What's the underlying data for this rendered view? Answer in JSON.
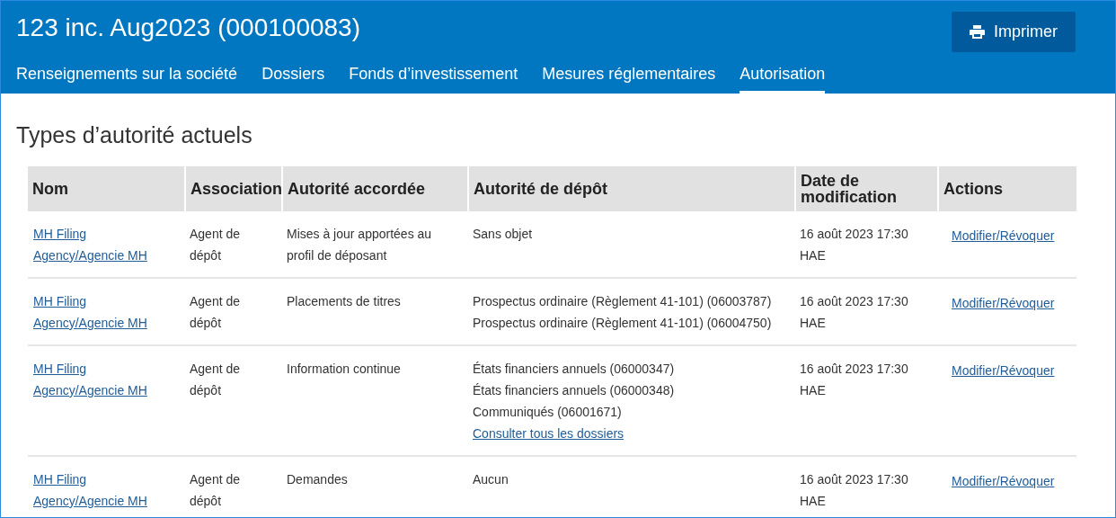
{
  "header": {
    "title": "123 inc. Aug2023 (000100083)",
    "print_button": "Imprimer"
  },
  "tabs": [
    {
      "label": "Renseignements sur la société",
      "selected": false
    },
    {
      "label": "Dossiers",
      "selected": false
    },
    {
      "label": "Fonds d’investissement",
      "selected": false
    },
    {
      "label": "Mesures réglementaires",
      "selected": false
    },
    {
      "label": "Autorisation",
      "selected": true
    }
  ],
  "section_title": "Types d’autorité actuels",
  "table": {
    "columns": [
      "Nom",
      "Association",
      "Autorité accordée",
      "Autorité de dépôt",
      "Date de modification",
      "Actions"
    ],
    "rows": [
      {
        "name": "MH Filing Agency/Agencie MH",
        "association": "Agent de dépôt",
        "granted": "Mises à jour apportées au profil de déposant",
        "filing": [
          {
            "kind": "text",
            "text": "Sans objet"
          }
        ],
        "date": "16 août 2023 17:30 HAE",
        "action": "Modifier/Révoquer"
      },
      {
        "name": "MH Filing Agency/Agencie MH",
        "association": "Agent de dépôt",
        "granted": "Placements de titres",
        "filing": [
          {
            "kind": "text",
            "text": "Prospectus ordinaire (Règlement 41-101) (06003787)"
          },
          {
            "kind": "text",
            "text": "Prospectus ordinaire (Règlement 41-101) (06004750)"
          }
        ],
        "date": "16 août 2023 17:30 HAE",
        "action": "Modifier/Révoquer"
      },
      {
        "name": "MH Filing Agency/Agencie MH",
        "association": "Agent de dépôt",
        "granted": "Information continue",
        "filing": [
          {
            "kind": "text",
            "text": "États financiers annuels (06000347)"
          },
          {
            "kind": "text",
            "text": "États financiers annuels (06000348)"
          },
          {
            "kind": "text",
            "text": "Communiqués (06001671)"
          },
          {
            "kind": "link",
            "text": "Consulter tous les dossiers"
          }
        ],
        "date": "16 août 2023 17:30 HAE",
        "action": "Modifier/Révoquer"
      },
      {
        "name": "MH Filing Agency/Agencie MH",
        "association": "Agent de dépôt",
        "granted": "Demandes",
        "filing": [
          {
            "kind": "text",
            "text": "Aucun"
          }
        ],
        "date": "16 août 2023 17:30 HAE",
        "action": "Modifier/Révoquer"
      }
    ]
  }
}
